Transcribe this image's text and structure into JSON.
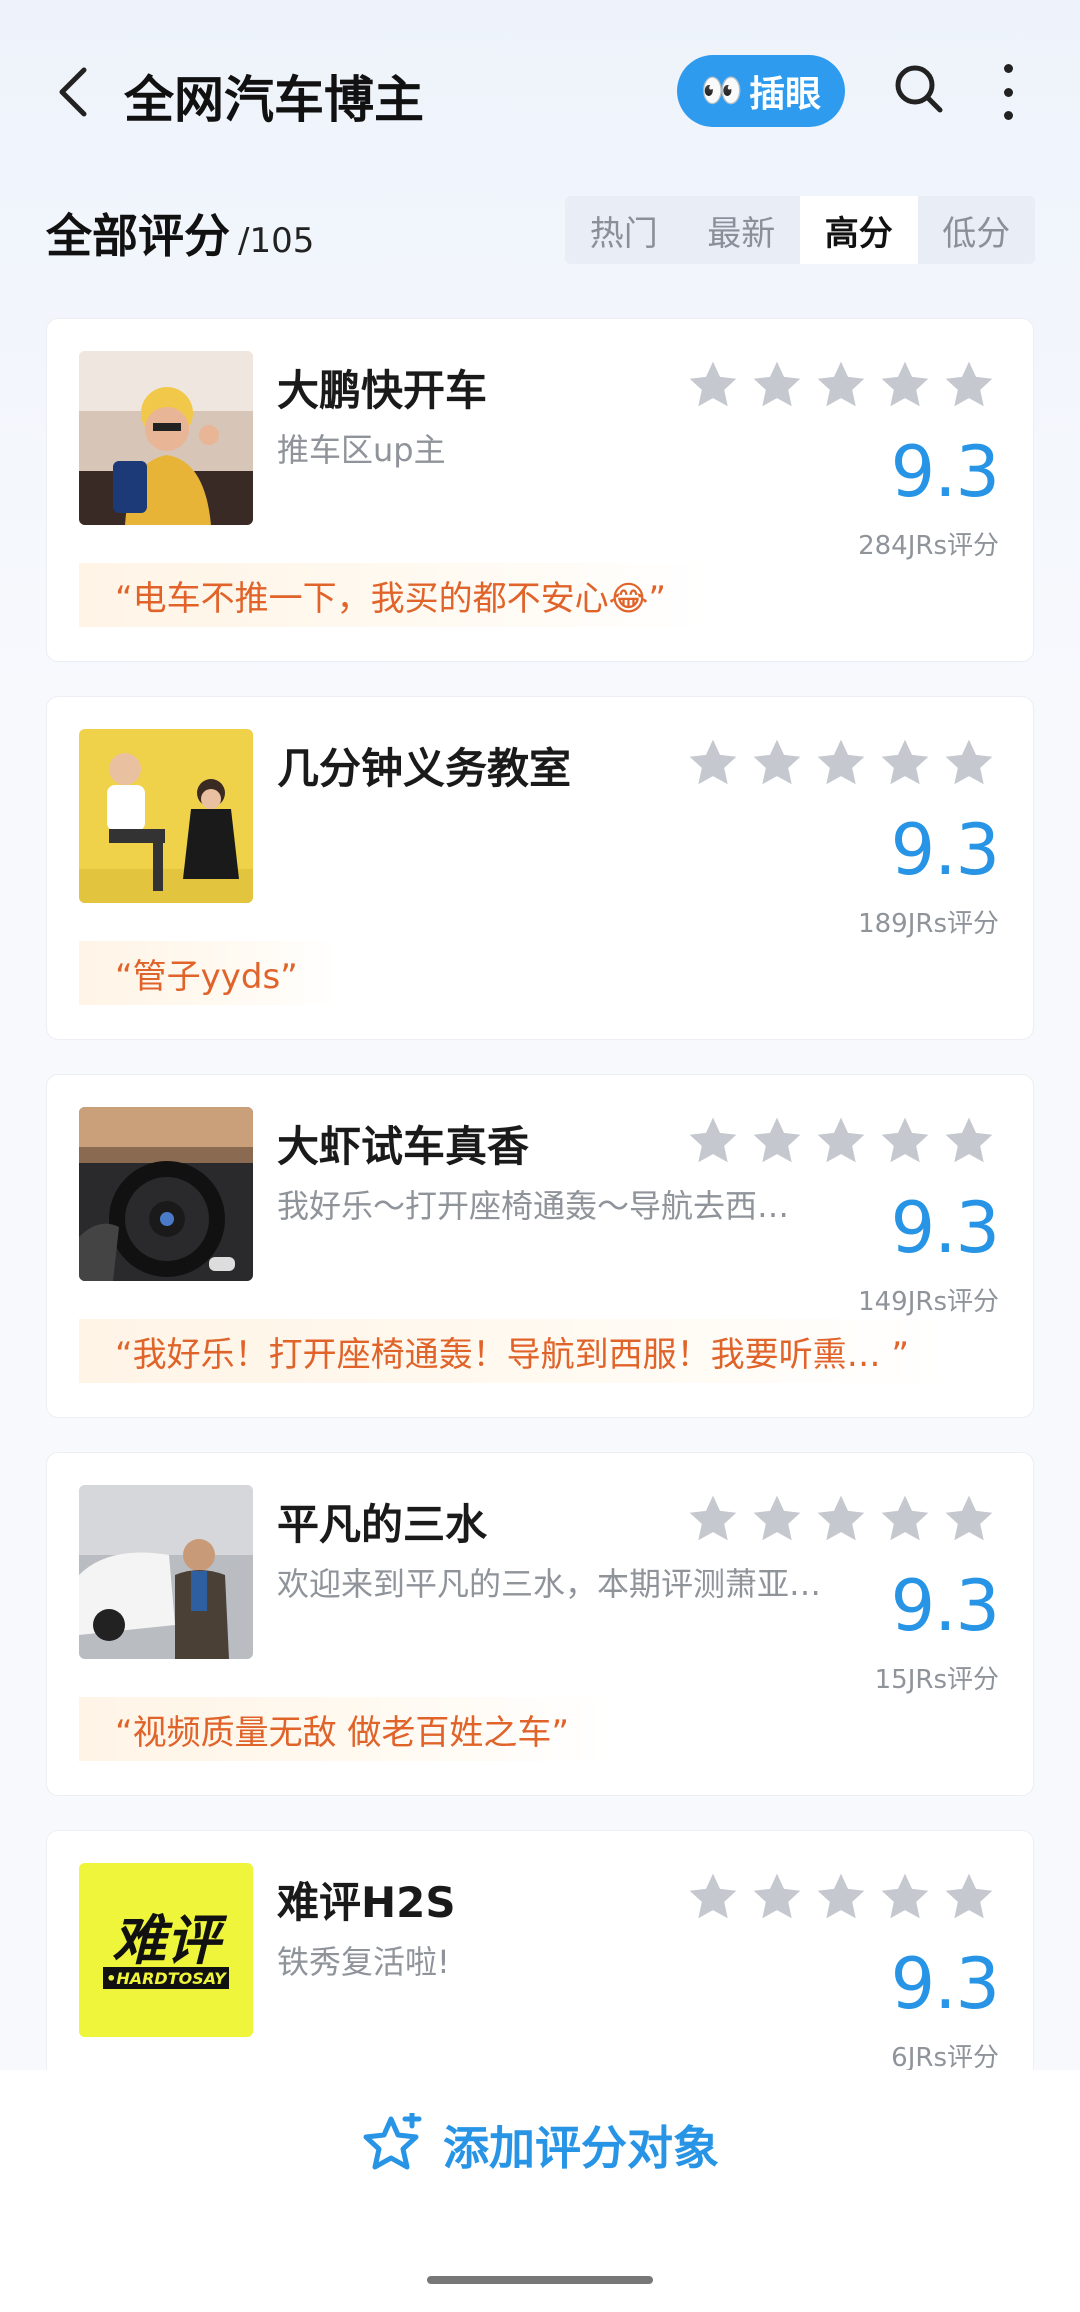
{
  "header": {
    "title": "全网汽车博主",
    "chayan_label": "插眼",
    "icons": {
      "back": "chevron-left-icon",
      "chayan": "eyes-icon",
      "search": "search-icon",
      "more": "more-vertical-icon"
    }
  },
  "section": {
    "title": "全部评分",
    "count": "/105"
  },
  "sort_tabs": [
    {
      "label": "热门",
      "active": false
    },
    {
      "label": "最新",
      "active": false
    },
    {
      "label": "高分",
      "active": true
    },
    {
      "label": "低分",
      "active": false
    }
  ],
  "items": [
    {
      "name": "大鹏快开车",
      "subtitle": "推车区up主",
      "stars": 5,
      "score": "9.3",
      "rating_count": "284JRs评分",
      "quote": "“电车不推一下，我买的都不安心😂”"
    },
    {
      "name": "几分钟义务教室",
      "subtitle": "",
      "stars": 5,
      "score": "9.3",
      "rating_count": "189JRs评分",
      "quote": "“管子yyds”"
    },
    {
      "name": "大虾试车真香",
      "subtitle": "我好乐～打开座椅通轰～导航去西…",
      "stars": 5,
      "score": "9.3",
      "rating_count": "149JRs评分",
      "quote": "“我好乐！打开座椅通轰！导航到西服！我要听熏… ”"
    },
    {
      "name": "平凡的三水",
      "subtitle": "欢迎来到平凡的三水，本期评测萧亚…",
      "stars": 5,
      "score": "9.3",
      "rating_count": "15JRs评分",
      "quote": "“视频质量无敌 做老百姓之车”"
    },
    {
      "name": "难评H2S",
      "subtitle": "铁秀复活啦!",
      "stars": 5,
      "score": "9.3",
      "rating_count": "6JRs评分",
      "quote": "",
      "logo_text_main": "难评",
      "logo_text_sub": "•HARDTOSAY"
    }
  ],
  "bottom": {
    "add_label": "添加评分对象",
    "icon": "star-plus-icon"
  },
  "colors": {
    "accent": "#2794e5",
    "quote_text": "#e0632a",
    "star_gray": "#c5c8ce"
  }
}
